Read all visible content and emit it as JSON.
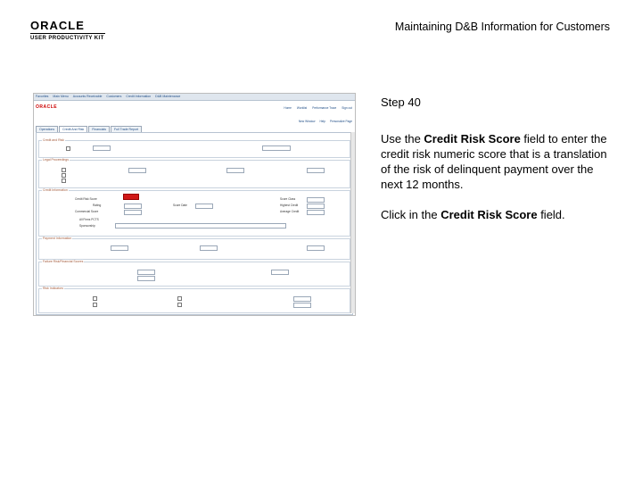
{
  "header": {
    "logo_word": "ORACLE",
    "logo_sub": "USER PRODUCTIVITY KIT",
    "title": "Maintaining D&B Information for Customers"
  },
  "step": {
    "label": "Step 40"
  },
  "instruction": {
    "p1_pre": "Use the ",
    "p1_bold": "Credit Risk Score",
    "p1_post": " field to enter the credit risk numeric score that is a translation of the risk of delinquent payment over the next 12 months.",
    "p2_pre": "Click in the ",
    "p2_bold": "Credit Risk Score",
    "p2_post": " field."
  },
  "screenshot": {
    "brand": "ORACLE",
    "tabs": [
      "Operations",
      "Credit And Risk",
      "Financials",
      "Full Trade Report"
    ],
    "sections": [
      "Credit and Risk",
      "Legal Proceedings",
      "Credit Information",
      "Payment Information",
      "Failure Risk/Financial Scores",
      "Risk Indicators"
    ],
    "fields": [
      "Credit Risk Score",
      "Rating",
      "Commercial Score",
      "All Firms PCTS",
      "Sponsorship",
      "Score Date",
      "Score Class",
      "Highest Credit",
      "Average Credit"
    ]
  },
  "colors": {
    "highlight": "#d01818",
    "link": "#1f4d86",
    "section_title": "#a35a3a"
  }
}
